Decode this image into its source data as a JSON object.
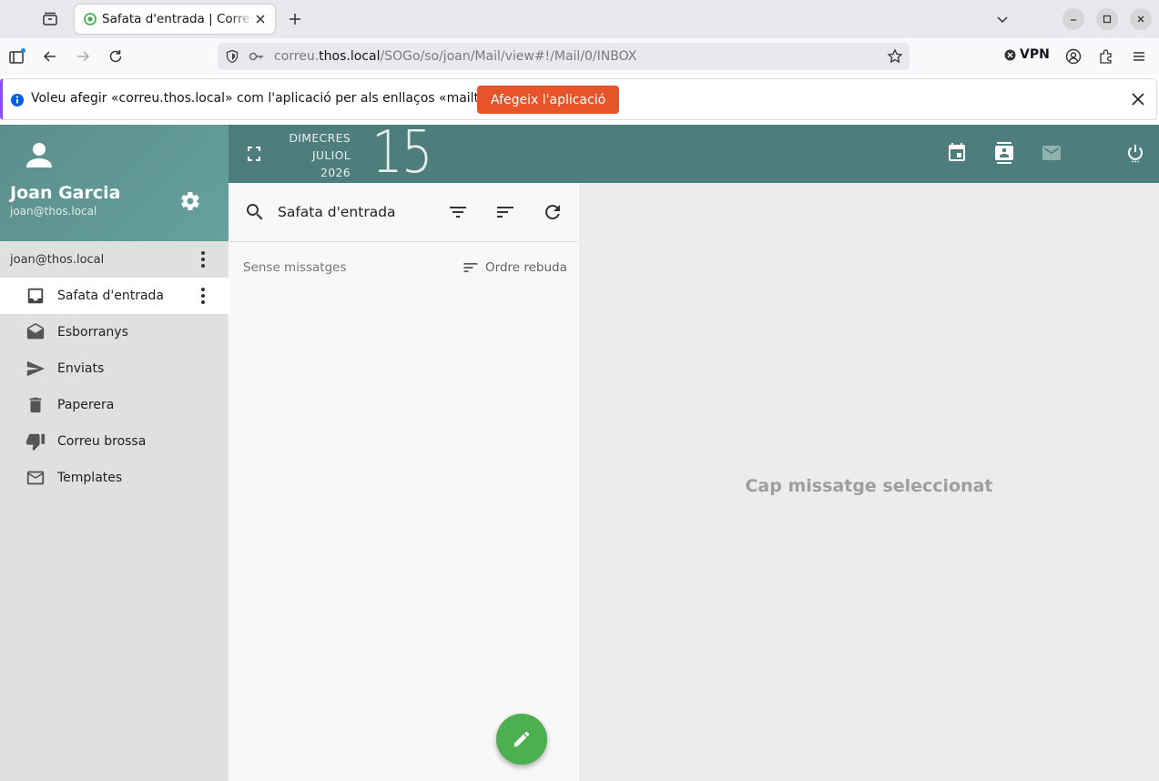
{
  "browser": {
    "tab_title": "Safata d'entrada | Correu",
    "url_host_prefix": "correu.",
    "url_host": "thos.local",
    "url_path": "/SOGo/so/joan/Mail/view#!/Mail/0/INBOX",
    "vpn_label": "VPN"
  },
  "notification": {
    "text": "Voleu afegir «correu.thos.local» com l'aplicació per als enllaços «mailto»?",
    "button_label": "Afegeix l'aplicació"
  },
  "user": {
    "name": "Joan Garcia",
    "email": "joan@thos.local"
  },
  "account": {
    "label": "joan@thos.local"
  },
  "folders": [
    {
      "label": "Safata d'entrada",
      "icon": "inbox-icon"
    },
    {
      "label": "Esborranys",
      "icon": "drafts-icon"
    },
    {
      "label": "Enviats",
      "icon": "send-icon"
    },
    {
      "label": "Paperera",
      "icon": "trash-icon"
    },
    {
      "label": "Correu brossa",
      "icon": "thumb-down-icon"
    },
    {
      "label": "Templates",
      "icon": "mail-outline-icon"
    }
  ],
  "date": {
    "weekday": "DIMECRES",
    "month": "JULIOL",
    "year": "2026",
    "day": "15"
  },
  "message_list": {
    "folder_title": "Safata d'entrada",
    "empty_text": "Sense missatges",
    "sort_label": "Ordre rebuda"
  },
  "viewer": {
    "empty_text": "Cap missatge seleccionat"
  },
  "colors": {
    "topbar": "#4d7d7c",
    "user_header": "#5a8e8c",
    "fab": "#4caf50",
    "notif_button": "#e8542a"
  }
}
